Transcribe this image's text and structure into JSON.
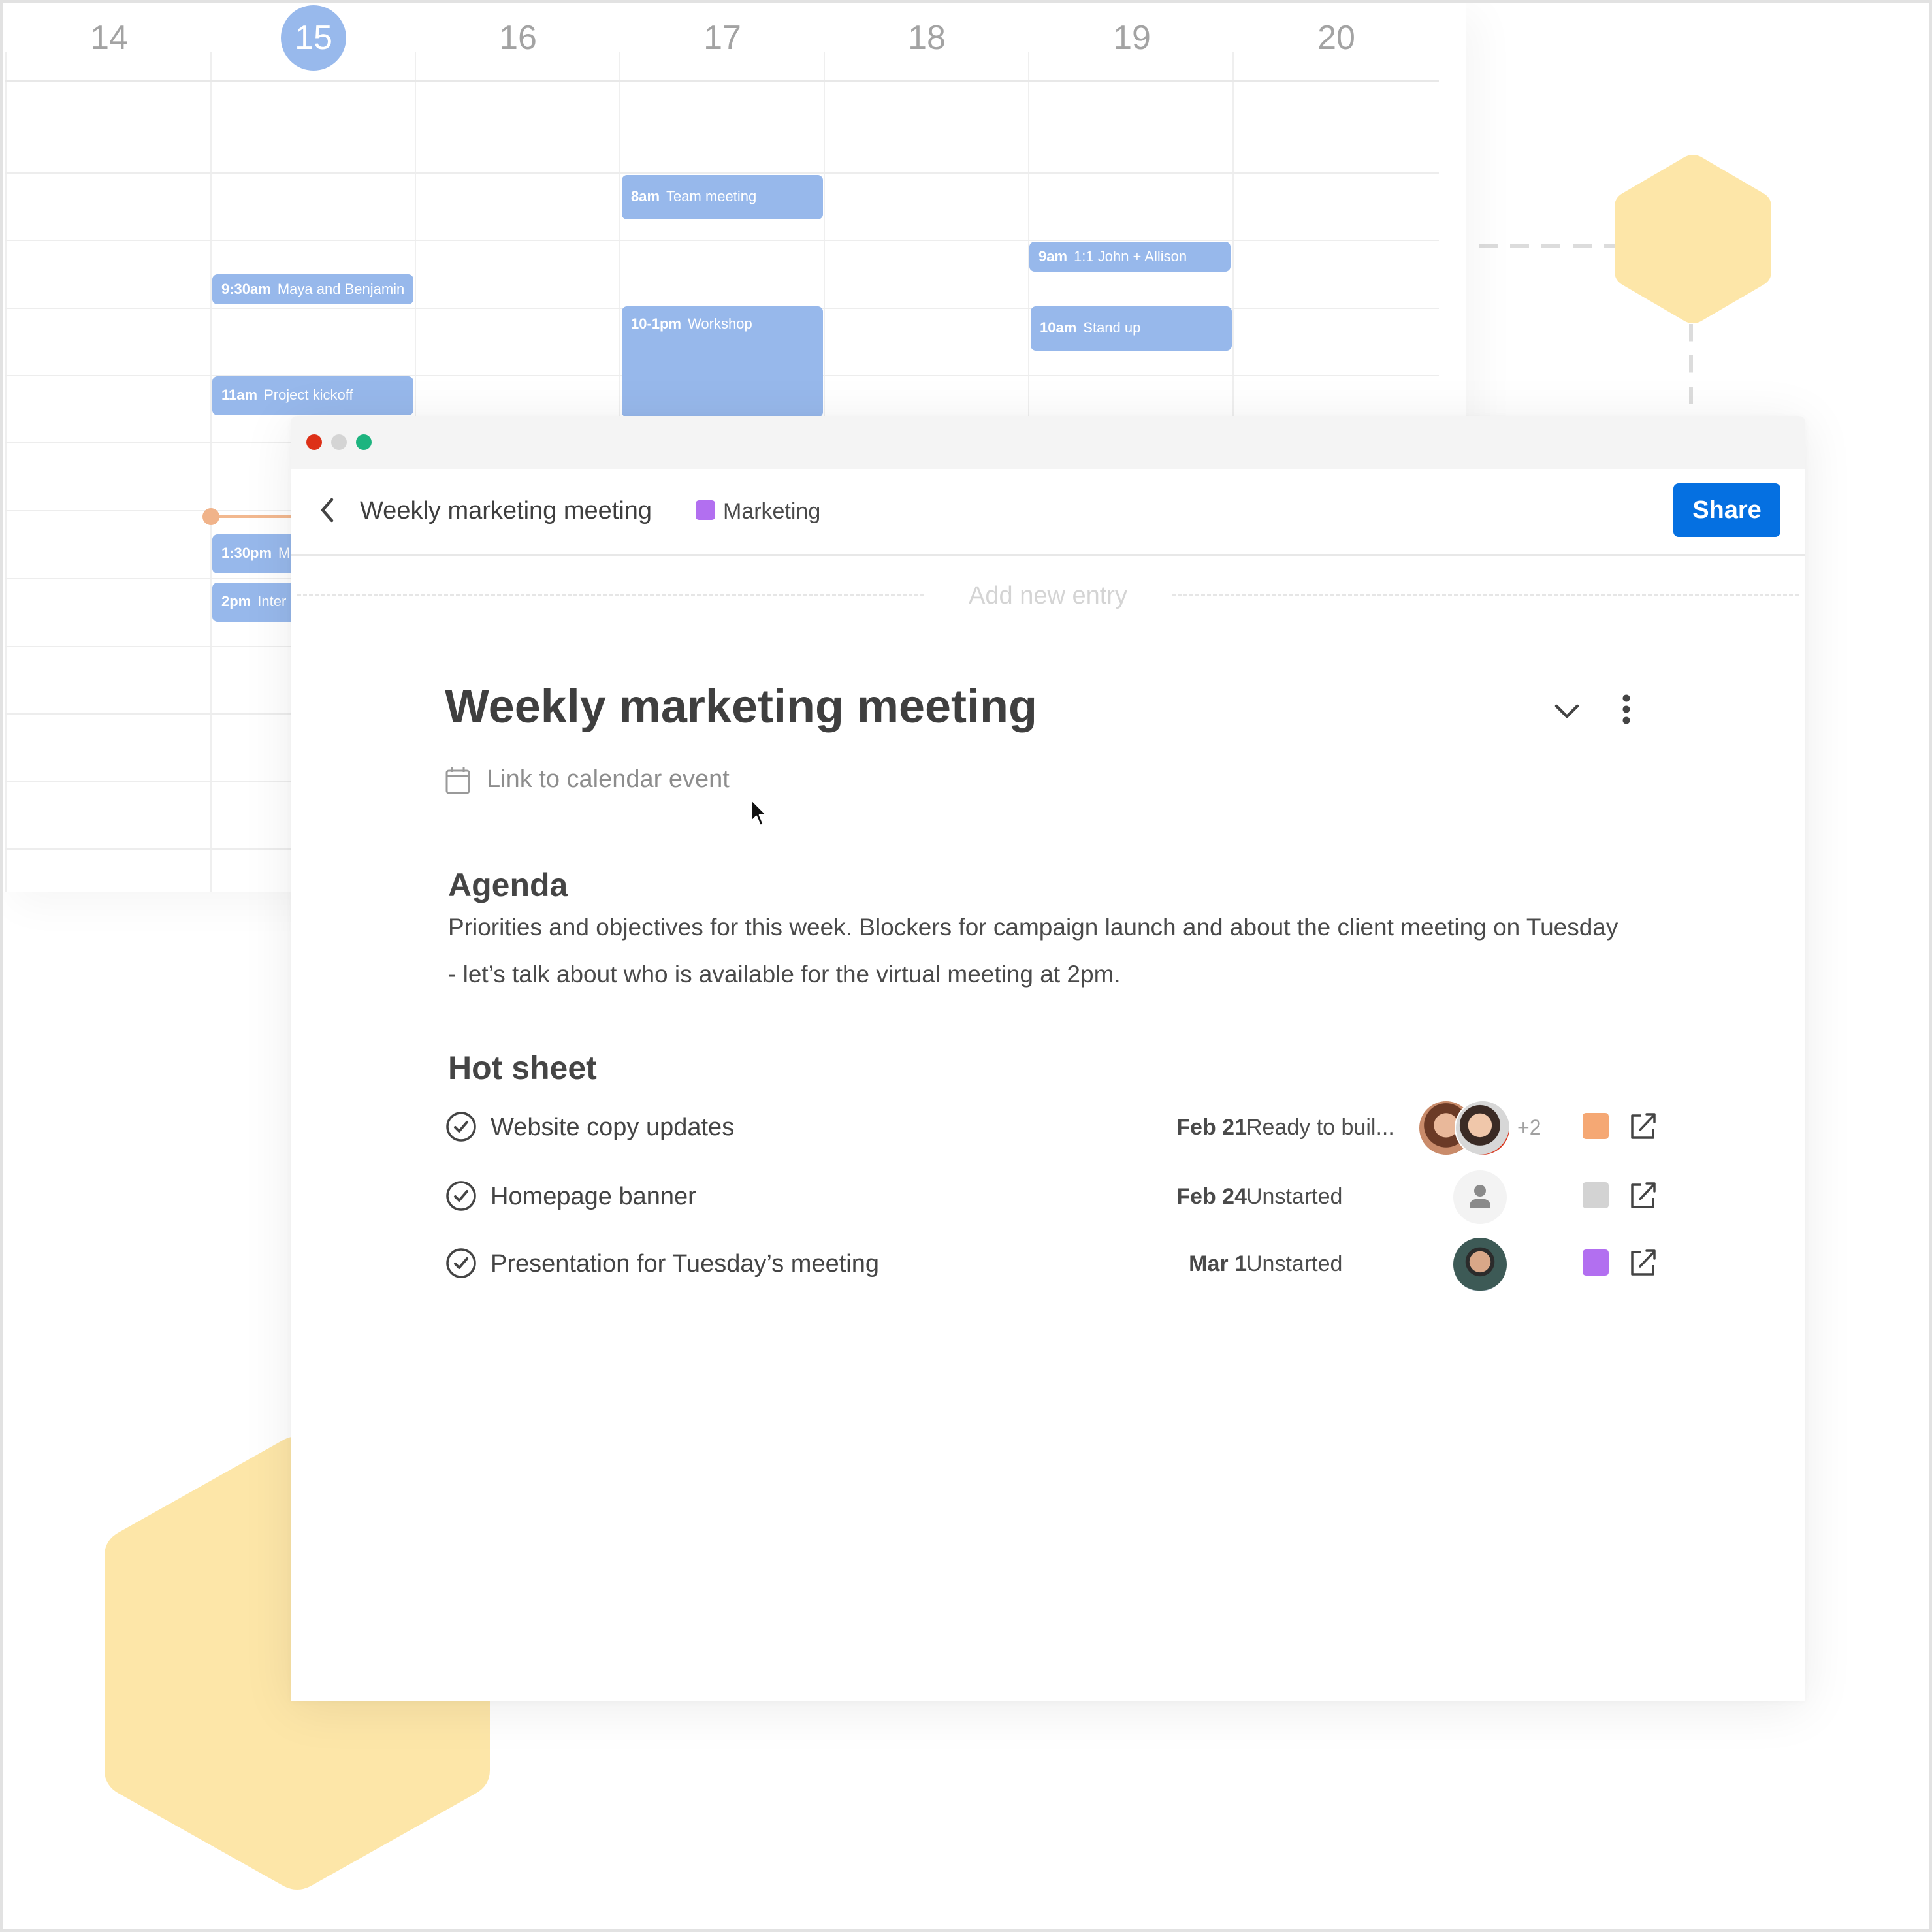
{
  "calendar": {
    "days": [
      {
        "label": "14",
        "today": false
      },
      {
        "label": "15",
        "today": true
      },
      {
        "label": "16",
        "today": false
      },
      {
        "label": "17",
        "today": false
      },
      {
        "label": "18",
        "today": false
      },
      {
        "label": "19",
        "today": false
      },
      {
        "label": "20",
        "today": false
      }
    ],
    "events": [
      {
        "day": "17",
        "time": "8am",
        "title": "Team meeting"
      },
      {
        "day": "19",
        "time": "9am",
        "title": "1:1 John + Allison"
      },
      {
        "day": "15",
        "time": "9:30am",
        "title": "Maya and Benjamin"
      },
      {
        "day": "17",
        "time": "10-1pm",
        "title": "Workshop"
      },
      {
        "day": "19",
        "time": "10am",
        "title": "Stand up"
      },
      {
        "day": "15",
        "time": "11am",
        "title": "Project kickoff"
      },
      {
        "day": "15",
        "time": "1:30pm",
        "title": "M"
      },
      {
        "day": "15",
        "time": "2pm",
        "title": "Inter"
      }
    ],
    "event_color": "#97b8eb",
    "today_color": "#98b9ec",
    "now_indicator_color": "#f0b38a"
  },
  "window": {
    "traffic_lights": [
      "#dd3017",
      "#d4d4d4",
      "#1db47f"
    ]
  },
  "toolbar": {
    "back_icon": "chevron-left-icon",
    "title": "Weekly marketing meeting",
    "tag_label": "Marketing",
    "tag_color": "#b26ff0",
    "share_label": "Share",
    "share_color": "#0570e1"
  },
  "add_entry": {
    "label": "Add new entry"
  },
  "document": {
    "title": "Weekly marketing meeting",
    "collapse_icon": "chevron-down-icon",
    "more_icon": "more-vertical-icon",
    "calendar_link_label": "Link to calendar event",
    "agenda": {
      "heading": "Agenda",
      "text": "Priorities and objectives for this week. Blockers for campaign launch and about the client meeting on Tuesday - let’s talk about who is available for the virtual meeting at 2pm."
    },
    "hot_sheet": {
      "heading": "Hot sheet",
      "items": [
        {
          "name": "Website copy updates",
          "date": "Feb 21",
          "status": "Ready to buil...",
          "assignees": [
            "photo-avatar-woman-1",
            "photo-avatar-woman-2"
          ],
          "extra_assignees": "+2",
          "color": "#f5a874"
        },
        {
          "name": "Homepage banner",
          "date": "Feb 24",
          "status": "Unstarted",
          "assignees": [
            "placeholder-avatar"
          ],
          "extra_assignees": "",
          "color": "#d3d3d3"
        },
        {
          "name": "Presentation for Tuesday’s meeting",
          "date": "Mar 1",
          "status": "Unstarted",
          "assignees": [
            "photo-avatar-man"
          ],
          "extra_assignees": "",
          "color": "#b26ff0"
        }
      ]
    }
  },
  "decor": {
    "hexagon_color": "#fde6a8",
    "dash_color": "#dcdcdc"
  }
}
